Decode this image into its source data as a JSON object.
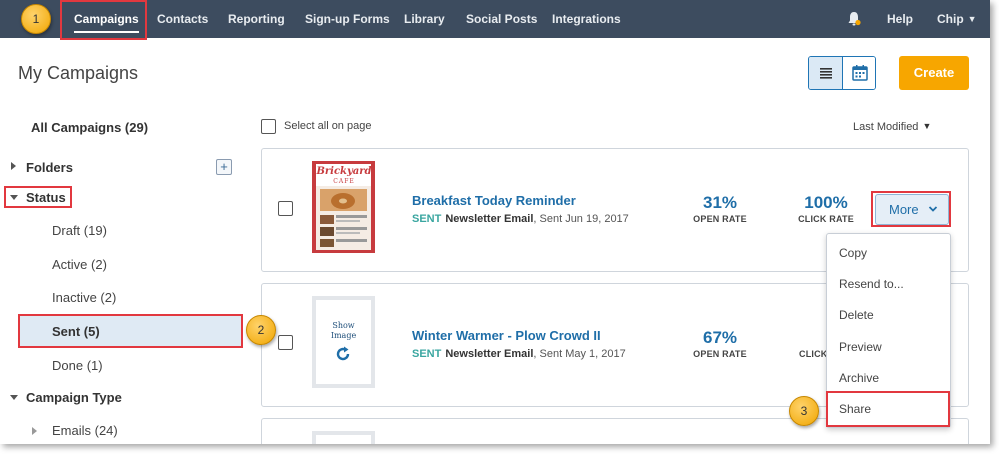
{
  "nav": {
    "items": [
      {
        "label": "Campaigns"
      },
      {
        "label": "Contacts"
      },
      {
        "label": "Reporting"
      },
      {
        "label": "Sign-up Forms"
      },
      {
        "label": "Library"
      },
      {
        "label": "Social Posts"
      },
      {
        "label": "Integrations"
      }
    ],
    "help": "Help",
    "user": "Chip",
    "bg_color": "#3d4c5f"
  },
  "callouts": [
    "1",
    "2",
    "3"
  ],
  "header": {
    "title": "My Campaigns",
    "create_label": "Create",
    "accent": "#f7a600"
  },
  "sidebar": {
    "all_campaigns": "All Campaigns (29)",
    "folders": "Folders",
    "status": "Status",
    "status_items": [
      {
        "label": "Draft (19)"
      },
      {
        "label": "Active (2)"
      },
      {
        "label": "Inactive (2)"
      },
      {
        "label": "Sent (5)"
      },
      {
        "label": "Done (1)"
      }
    ],
    "campaign_type": "Campaign Type",
    "emails": "Emails (24)"
  },
  "list": {
    "select_all": "Select all on page",
    "sort": "Last Modified",
    "campaigns": [
      {
        "name": "Breakfast Today Reminder",
        "status": "SENT",
        "type": "Newsletter Email",
        "date": ", Sent Jun 19, 2017",
        "open_rate": "31%",
        "open_label": "OPEN RATE",
        "click_rate": "100%",
        "click_label": "CLICK RATE",
        "thumb_brand": "Brickyard",
        "thumb_sub": "CAFE"
      },
      {
        "name": "Winter Warmer - Plow Crowd II",
        "status": "SENT",
        "type": "Newsletter Email",
        "date": ", Sent May 1, 2017",
        "open_rate": "67%",
        "open_label": "OPEN RATE",
        "click_partial": "CLICK",
        "thumb_show": "Show",
        "thumb_image": "Image"
      }
    ],
    "more_label": "More"
  },
  "dropdown": {
    "items": [
      "Copy",
      "Resend to...",
      "Delete",
      "Preview",
      "Archive",
      "Share"
    ]
  },
  "colors": {
    "link": "#1f6ea8",
    "sent_status": "#3aa6a0",
    "highlight_box": "#e2383f"
  }
}
